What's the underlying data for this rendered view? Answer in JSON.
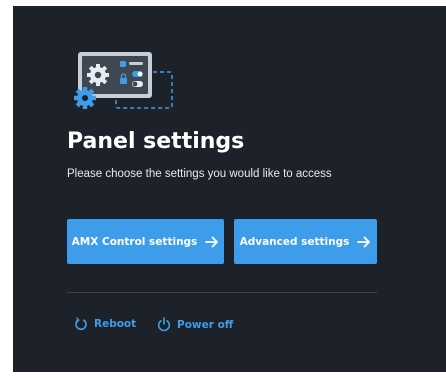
{
  "panel": {
    "title": "Panel settings",
    "subtitle": "Please choose the settings you would like to access"
  },
  "buttons": {
    "amx_label": "AMX Control settings",
    "advanced_label": "Advanced settings"
  },
  "actions": {
    "reboot_label": "Reboot",
    "power_off_label": "Power off"
  },
  "icons": {
    "illustration": "settings-panel-illustration",
    "arrow": "arrow-right-icon",
    "reboot": "reboot-icon",
    "power": "power-icon"
  },
  "colors": {
    "background": "#1d222a",
    "accent": "#3e9dea",
    "text": "#ffffff",
    "divider": "#3b424c"
  }
}
